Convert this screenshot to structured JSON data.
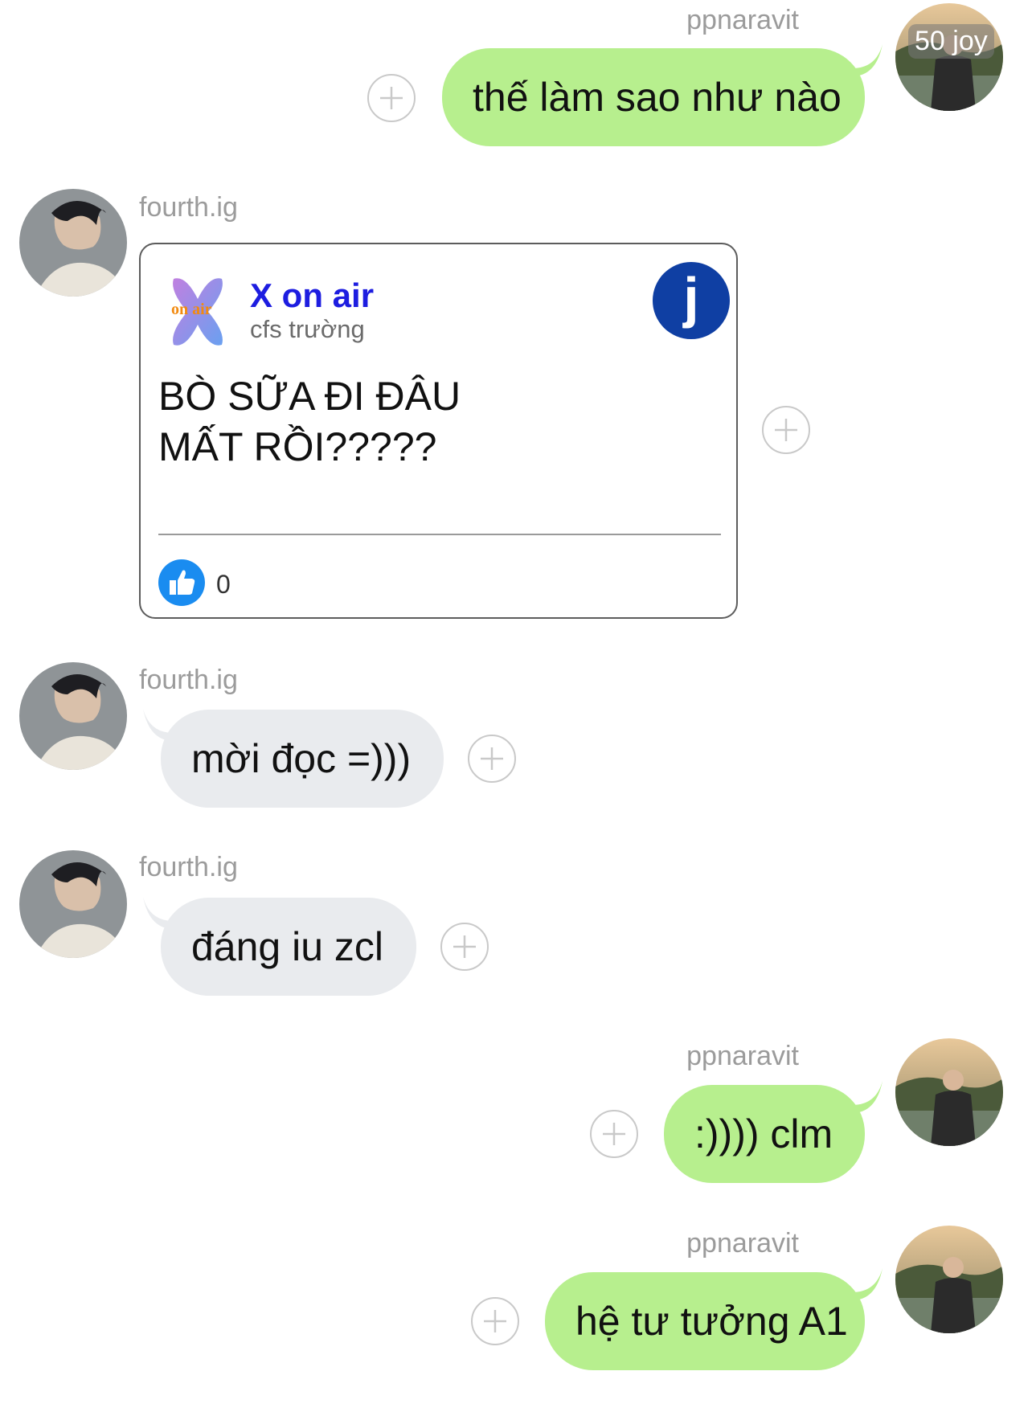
{
  "messages": [
    {
      "sender": "ppnaravit",
      "text": "thế làm sao như nào",
      "badge": "50 joy"
    },
    {
      "sender": "fourth.ig",
      "card": {
        "page_name": "X on air",
        "subtitle": "cfs trường",
        "logo_text": "on air",
        "body_line1": "BÒ SỮA ĐI ĐÂU",
        "body_line2": "MẤT RỒI?????",
        "like_count": "0",
        "badge_letter": "j"
      }
    },
    {
      "sender": "fourth.ig",
      "text": "mời đọc =)))"
    },
    {
      "sender": "fourth.ig",
      "text": "đáng iu zcl"
    },
    {
      "sender": "ppnaravit",
      "text": ":)))) clm"
    },
    {
      "sender": "ppnaravit",
      "text": "hệ tư tưởng A1"
    }
  ],
  "colors": {
    "outgoing_bubble": "#b7ef8e",
    "incoming_bubble": "#e9ebee",
    "sender_name": "#9b9b9b",
    "page_name": "#1d1de0",
    "like_icon": "#1a8cf0",
    "badge_circle": "#0f3fa3"
  },
  "icons": {
    "add_reaction": "plus-circle-icon",
    "like": "thumbs-up-icon"
  }
}
